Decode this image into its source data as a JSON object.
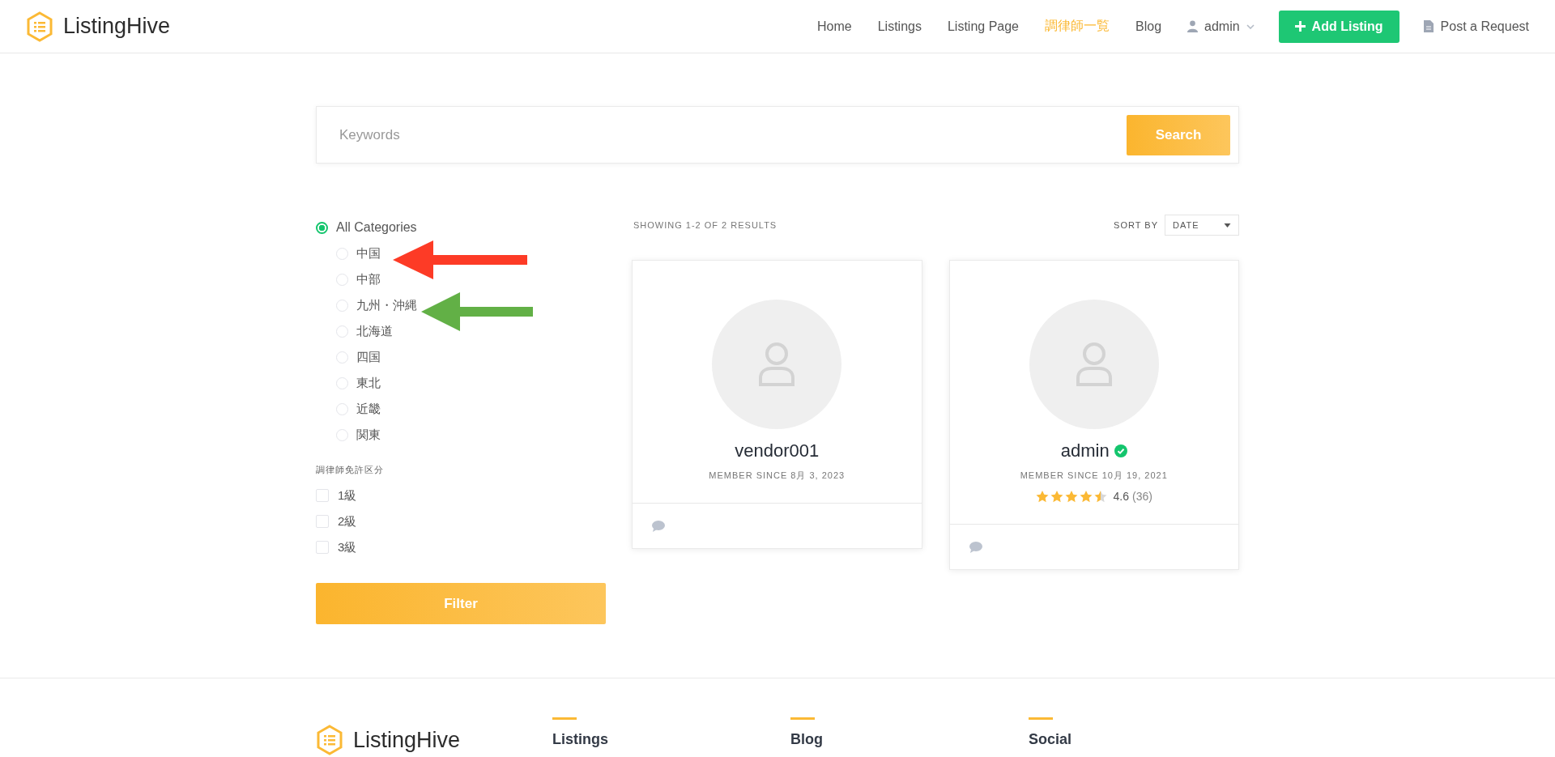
{
  "header": {
    "logo": "ListingHive",
    "nav": [
      {
        "label": "Home",
        "selected": false
      },
      {
        "label": "Listings",
        "selected": false
      },
      {
        "label": "Listing Page",
        "selected": false
      },
      {
        "label": "調律師一覧",
        "selected": true
      },
      {
        "label": "Blog",
        "selected": false
      }
    ],
    "user_menu": "admin",
    "add_button": "Add Listing",
    "request_link": "Post a Request"
  },
  "search": {
    "placeholder": "Keywords",
    "button": "Search"
  },
  "filters": {
    "categories": [
      {
        "label": "All Categories",
        "selected": true,
        "children": [
          {
            "label": "中国",
            "selected": false
          },
          {
            "label": "中部",
            "selected": false
          },
          {
            "label": "九州・沖縄",
            "selected": false
          },
          {
            "label": "北海道",
            "selected": false
          },
          {
            "label": "四国",
            "selected": false
          },
          {
            "label": "東北",
            "selected": false
          },
          {
            "label": "近畿",
            "selected": false
          },
          {
            "label": "関東",
            "selected": false
          }
        ]
      }
    ],
    "license_title": "調律師免許区分",
    "licenses": [
      {
        "label": "1級",
        "checked": false
      },
      {
        "label": "2級",
        "checked": false
      },
      {
        "label": "3級",
        "checked": false
      }
    ],
    "button": "Filter"
  },
  "results": {
    "count": "SHOWING 1-2 OF 2 RESULTS",
    "sort_label": "SORT BY",
    "sort_value": "DATE",
    "vendors": [
      {
        "name": "vendor001",
        "verified": false,
        "member_since": "MEMBER SINCE 8月 3, 2023"
      },
      {
        "name": "admin",
        "verified": true,
        "member_since": "MEMBER SINCE 10月 19, 2021",
        "stars": 4.5,
        "rating": "4.6",
        "reviews": "(36)"
      }
    ]
  },
  "footer": {
    "logo": "ListingHive",
    "columns": [
      "Listings",
      "Blog",
      "Social"
    ]
  }
}
